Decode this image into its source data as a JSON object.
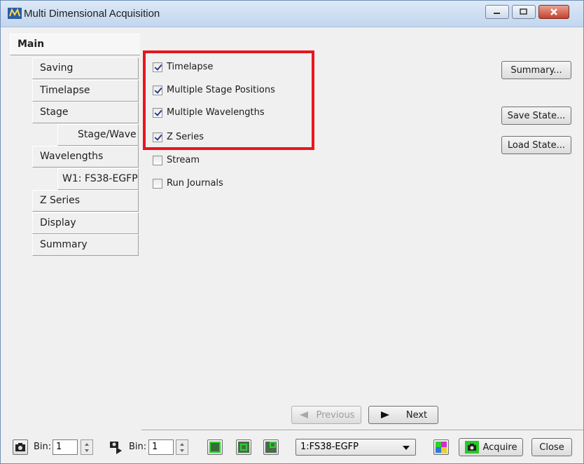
{
  "window": {
    "title": "Multi Dimensional Acquisition"
  },
  "tabs": {
    "main": "Main",
    "items": [
      {
        "label": "Saving"
      },
      {
        "label": "Timelapse"
      },
      {
        "label": "Stage"
      },
      {
        "label": "Stage/Wave"
      },
      {
        "label": "Wavelengths"
      },
      {
        "label": "W1: FS38-EGFP"
      },
      {
        "label": "Z Series"
      },
      {
        "label": "Display"
      },
      {
        "label": "Summary"
      }
    ]
  },
  "options": [
    {
      "label": "Timelapse",
      "checked": true
    },
    {
      "label": "Multiple Stage Positions",
      "checked": true
    },
    {
      "label": "Multiple Wavelengths",
      "checked": true
    },
    {
      "label": "Z Series",
      "checked": true
    },
    {
      "label": "Stream",
      "checked": false
    },
    {
      "label": "Run Journals",
      "checked": false
    }
  ],
  "side_buttons": {
    "summary": "Summary...",
    "save_state": "Save State...",
    "load_state": "Load State..."
  },
  "nav": {
    "previous": "Previous",
    "next": "Next"
  },
  "toolbar": {
    "bin1_label": "Bin:",
    "bin1_value": "1",
    "bin2_label": "Bin:",
    "bin2_value": "1",
    "wavelength_select": "1:FS38-EGFP",
    "acquire": "Acquire",
    "close": "Close"
  },
  "colors": {
    "highlight": "#e8161d",
    "checkmark": "#2c3e8c",
    "acquire_icon_bg": "#28c828"
  }
}
